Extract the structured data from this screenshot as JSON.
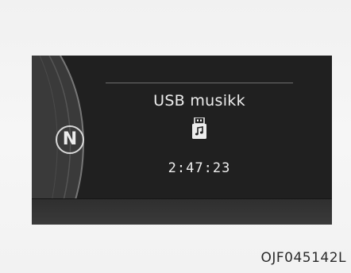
{
  "display": {
    "gear": "N",
    "media_title": "USB musikk",
    "play_time": "2:47:23",
    "media_icon": "usb-music-icon"
  },
  "figure_code": "OJF045142L",
  "colors": {
    "cluster_background": "#202020",
    "text": "#ededed",
    "page_background": "#f4f4f4"
  }
}
